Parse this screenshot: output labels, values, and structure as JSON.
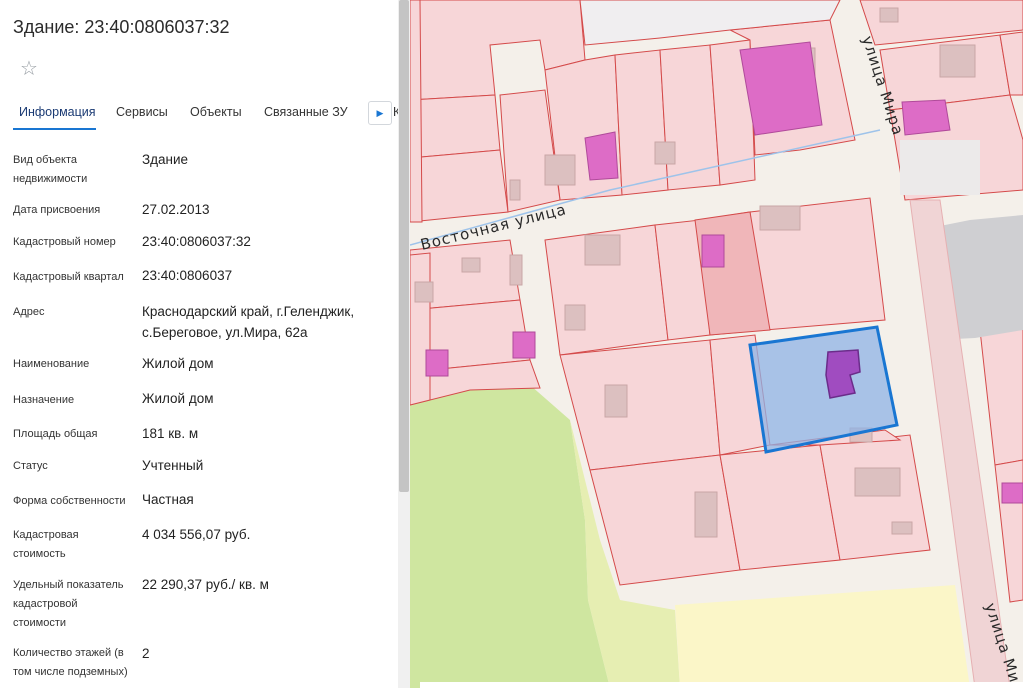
{
  "panel": {
    "title": "Здание: 23:40:0806037:32",
    "favorite_icon": "star-outline-icon",
    "tabs": [
      {
        "label": "Информация",
        "active": true
      },
      {
        "label": "Сервисы",
        "active": false
      },
      {
        "label": "Объекты",
        "active": false
      },
      {
        "label": "Связанные ЗУ",
        "active": false
      },
      {
        "label": "К",
        "active": false
      }
    ],
    "tabs_next_icon": "chevron-right-icon",
    "fields": [
      {
        "label": "Вид объекта недвижимости",
        "value": "Здание"
      },
      {
        "label": "Дата присвоения",
        "value": "27.02.2013"
      },
      {
        "label": "Кадастровый номер",
        "value": "23:40:0806037:32"
      },
      {
        "label": "Кадастровый квартал",
        "value": "23:40:0806037"
      },
      {
        "label": "Адрес",
        "value": "Краснодарский край, г.Геленджик, с.Береговое, ул.Мира, 62а"
      },
      {
        "label": "Наименование",
        "value": "Жилой дом"
      },
      {
        "label": "Назначение",
        "value": "Жилой дом"
      },
      {
        "label": "Площадь общая",
        "value": "181 кв. м"
      },
      {
        "label": "Статус",
        "value": "Учтенный"
      },
      {
        "label": "Форма собственности",
        "value": "Частная"
      },
      {
        "label": "Кадастровая стоимость",
        "value": "4 034 556,07 руб."
      },
      {
        "label": "Удельный показатель кадастровой стоимости",
        "value": "22 290,37 руб./ кв. м"
      },
      {
        "label": "Количество этажей (в том числе подземных)",
        "value": "2"
      }
    ]
  },
  "map": {
    "streets": [
      "Восточная улица",
      "улица Мира",
      "улица Мира"
    ],
    "colors": {
      "parcel_fill": "#f7d6d8",
      "parcel_border": "#d44a4a",
      "building_fill": "#d9b4b5",
      "building_highlight": "#dd6cc6",
      "selected_fill": "#8fb3e6",
      "selected_border": "#1976d2",
      "selected_building": "#a04cc0",
      "park_green": "#cfe6a0",
      "park_yellow": "#fbf6c8",
      "road": "#f4f0ea"
    }
  }
}
